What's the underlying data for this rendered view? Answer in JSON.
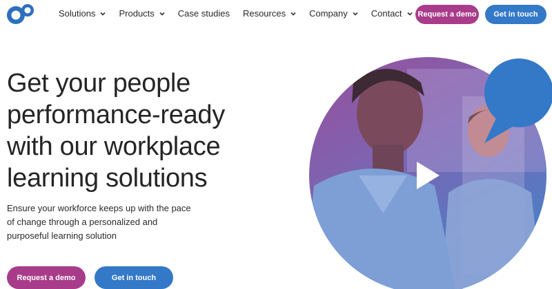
{
  "header": {
    "logo_icon": "brand-logo-icon",
    "nav": [
      {
        "label": "Solutions",
        "has_dropdown": true
      },
      {
        "label": "Products",
        "has_dropdown": true
      },
      {
        "label": "Case studies",
        "has_dropdown": false
      },
      {
        "label": "Resources",
        "has_dropdown": true
      },
      {
        "label": "Company",
        "has_dropdown": true
      },
      {
        "label": "Contact",
        "has_dropdown": true
      }
    ],
    "request_demo_label": "Request a demo",
    "get_in_touch_label": "Get in touch"
  },
  "hero": {
    "headline_lines": [
      "Get your people",
      "performance-ready",
      "with our workplace",
      "learning solutions"
    ],
    "subtext_lines": [
      "Ensure your workforce keeps up with the pace",
      "of change through a personalized and",
      "purposeful learning solution"
    ],
    "request_demo_label": "Request a demo",
    "get_in_touch_label": "Get in touch",
    "video_play_icon": "play-icon",
    "speech_bubble_icon": "speech-bubble-icon"
  },
  "colors": {
    "brand_blue": "#3478c8",
    "brand_magenta": "#a83c8a",
    "headline_text": "#252525"
  }
}
